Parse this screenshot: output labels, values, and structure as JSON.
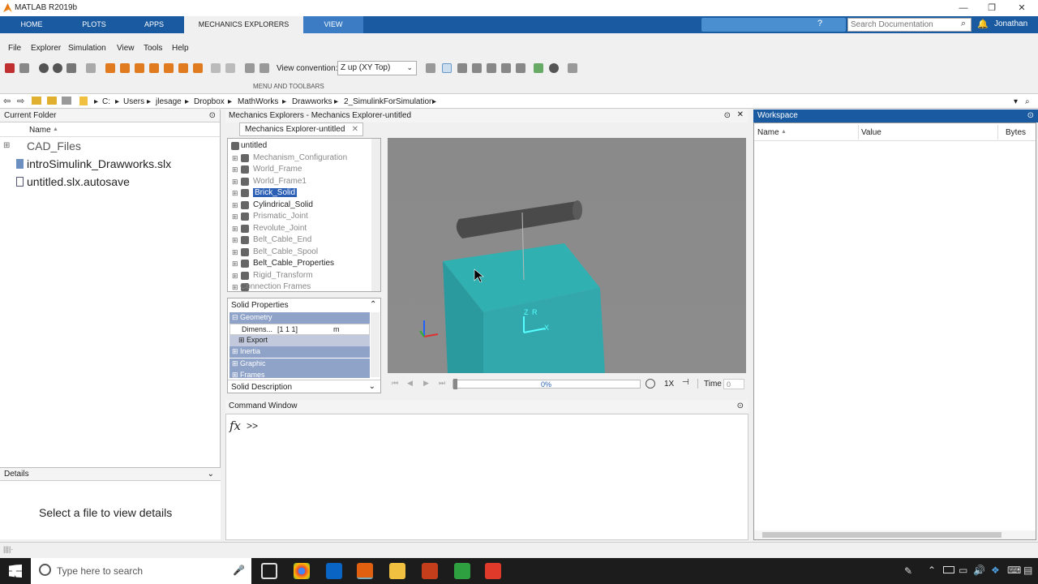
{
  "window": {
    "title": "MATLAB R2019b"
  },
  "ribbon": {
    "tabs": [
      "HOME",
      "PLOTS",
      "APPS",
      "MECHANICS EXPLORERS",
      "VIEW"
    ],
    "search_placeholder": "Search Documentation",
    "user": "Jonathan"
  },
  "toolstrip": {
    "menus": [
      "File",
      "Explorer",
      "Simulation",
      "View",
      "Tools",
      "Help"
    ],
    "view_convention_label": "View convention:",
    "view_convention_value": "Z up (XY Top)",
    "section_label": "MENU AND TOOLBARS"
  },
  "address": {
    "crumbs": [
      "C:",
      "Users",
      "jlesage",
      "Dropbox",
      "MathWorks",
      "Drawworks",
      "2_SimulinkForSimulation"
    ]
  },
  "current_folder": {
    "title": "Current Folder",
    "col_name": "Name",
    "sort": "▲",
    "files": [
      {
        "name": "CAD_Files",
        "type": "folder"
      },
      {
        "name": "introSimulink_Drawworks.slx",
        "type": "model"
      },
      {
        "name": "untitled.slx.autosave",
        "type": "file"
      }
    ]
  },
  "details": {
    "title": "Details",
    "message": "Select a file to view details"
  },
  "mechanics": {
    "title": "Mechanics Explorers - Mechanics Explorer-untitled",
    "tab": "Mechanics Explorer-untitled",
    "tree": [
      {
        "label": "untitled",
        "style": "b"
      },
      {
        "label": "Mechanism_Configuration",
        "style": ""
      },
      {
        "label": "World_Frame",
        "style": ""
      },
      {
        "label": "World_Frame1",
        "style": ""
      },
      {
        "label": "Brick_Solid",
        "style": "sel"
      },
      {
        "label": "Cylindrical_Solid",
        "style": "b"
      },
      {
        "label": "Prismatic_Joint",
        "style": ""
      },
      {
        "label": "Revolute_Joint",
        "style": ""
      },
      {
        "label": "Belt_Cable_End",
        "style": ""
      },
      {
        "label": "Belt_Cable_Spool",
        "style": ""
      },
      {
        "label": "Belt_Cable_Properties",
        "style": "b"
      },
      {
        "label": "Rigid_Transform",
        "style": ""
      },
      {
        "label": "Connection Frames",
        "style": ""
      }
    ],
    "props_title": "Solid Properties",
    "props": [
      {
        "label": "Geometry",
        "value": "",
        "unit": ""
      },
      {
        "label": "Dimens...",
        "value": "[1 1 1]",
        "unit": "m"
      },
      {
        "label": "Export",
        "value": "",
        "unit": ""
      },
      {
        "label": "Inertia",
        "value": "",
        "unit": ""
      },
      {
        "label": "Graphic",
        "value": "",
        "unit": ""
      },
      {
        "label": "Frames",
        "value": "",
        "unit": ""
      }
    ],
    "desc_title": "Solid Description",
    "progress": "0%",
    "speed": "1X",
    "time_label": "Time",
    "time_value": "0",
    "axis_labels": {
      "z": "Z",
      "r": "R",
      "x": "X"
    }
  },
  "command": {
    "title": "Command Window",
    "fx": "fx",
    "prompt": ">>"
  },
  "workspace": {
    "title": "Workspace",
    "cols": [
      "Name",
      "Value",
      "Bytes"
    ],
    "sort": "▲"
  },
  "taskbar": {
    "search_placeholder": "Type here to search"
  }
}
